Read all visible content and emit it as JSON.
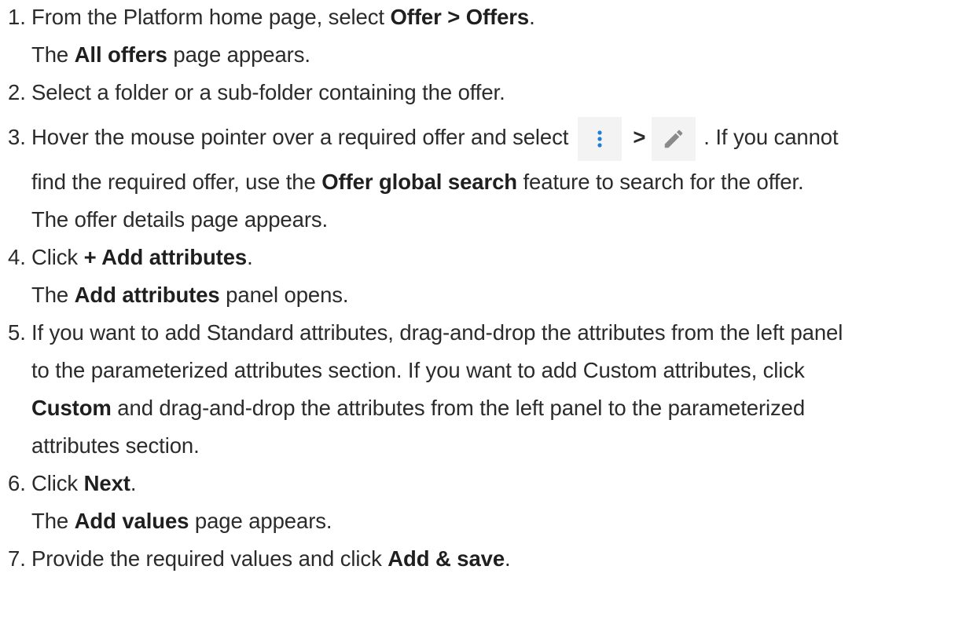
{
  "steps": [
    {
      "num": "1.",
      "lines": [
        [
          "From the Platform home page, select ",
          "Offer > Offers",
          "."
        ]
      ],
      "result": [
        "The ",
        "All offers",
        " page appears."
      ]
    },
    {
      "num": "2.",
      "lines": [
        [
          "Select a folder or a sub-folder containing the offer."
        ]
      ]
    },
    {
      "num": "3.",
      "line1_text": "Hover the mouse pointer over a required offer and select",
      "icon1": "kebab-menu-icon",
      "separator": ">",
      "icon2": "pencil-edit-icon",
      "line1_after": ". If you cannot",
      "line2": [
        "find the required offer, use the ",
        "Offer global search",
        " feature to search for the offer."
      ],
      "result": "The offer details page appears."
    },
    {
      "num": "4.",
      "lines": [
        [
          "Click ",
          "+ Add attributes",
          "."
        ]
      ],
      "result": [
        "The ",
        "Add attributes",
        " panel opens."
      ]
    },
    {
      "num": "5.",
      "line1": "If you want to add Standard attributes, drag-and-drop the attributes from the left panel",
      "line2": "to the parameterized attributes section. If you want to add Custom attributes, click",
      "line3": [
        "Custom",
        " and drag-and-drop the attributes from the left panel to the parameterized"
      ],
      "line4": "attributes section."
    },
    {
      "num": "6.",
      "lines": [
        [
          "Click ",
          "Next",
          "."
        ]
      ],
      "result": [
        "The ",
        "Add values",
        " page appears."
      ]
    },
    {
      "num": "7.",
      "lines": [
        [
          "Provide the required values and click ",
          "Add & save",
          "."
        ]
      ]
    }
  ],
  "colors": {
    "text": "#2b2b2b",
    "icon_bg": "#f3f3f3",
    "kebab": "#1f7fd6",
    "pencil": "#8a8a8a"
  }
}
